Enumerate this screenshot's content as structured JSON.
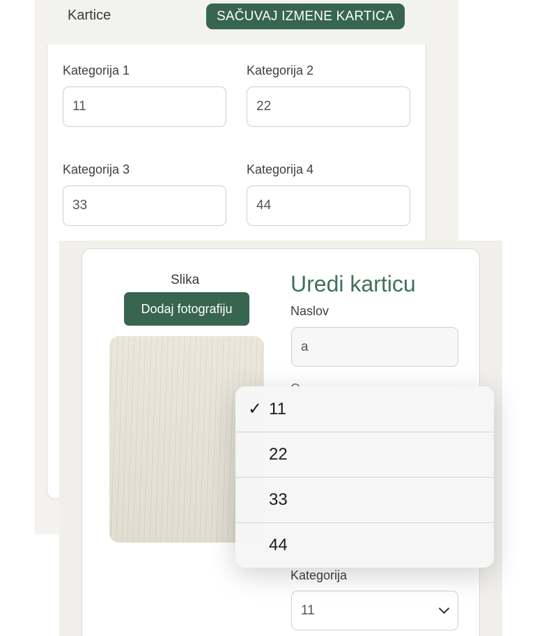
{
  "background_form": {
    "header_title": "Kartice",
    "save_button_label": "SAČUVAJ IZMENE KARTICA",
    "categories": [
      {
        "label": "Kategorija 1",
        "value": "11"
      },
      {
        "label": "Kategorija 2",
        "value": "22"
      },
      {
        "label": "Kategorija 3",
        "value": "33"
      },
      {
        "label": "Kategorija 4",
        "value": "44"
      }
    ]
  },
  "edit_sheet": {
    "image_label": "Slika",
    "add_photo_label": "Dodaj fotografiju",
    "title": "Uredi karticu",
    "naslov_label": "Naslov",
    "naslov_value": "a",
    "partially_hidden_label": "O",
    "kategorija_label": "Kategorija",
    "kategorija_selected": "11"
  },
  "dropdown_menu": {
    "options": [
      "11",
      "22",
      "33",
      "44"
    ],
    "selected": "11",
    "check_glyph": "✓"
  },
  "colors": {
    "accent_green": "#376550",
    "title_green": "#3f7258"
  }
}
